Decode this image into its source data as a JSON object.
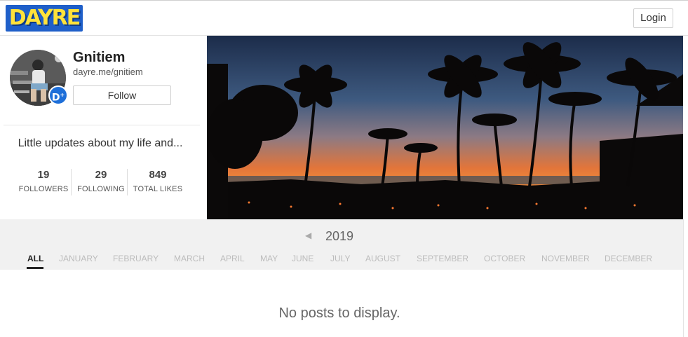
{
  "header": {
    "logo_text": "DAYRE",
    "login_label": "Login"
  },
  "profile": {
    "name": "Gnitiem",
    "handle": "dayre.me/gnitiem",
    "follow_label": "Follow",
    "badge_text": "D",
    "bio": "Little updates about my life and...",
    "stats": [
      {
        "value": "19",
        "label": "FOLLOWERS"
      },
      {
        "value": "29",
        "label": "FOLLOWING"
      },
      {
        "value": "849",
        "label": "TOTAL LIKES"
      }
    ]
  },
  "timeline": {
    "year": "2019",
    "months": [
      "ALL",
      "JANUARY",
      "FEBRUARY",
      "MARCH",
      "APRIL",
      "MAY",
      "JUNE",
      "JULY",
      "AUGUST",
      "SEPTEMBER",
      "OCTOBER",
      "NOVEMBER",
      "DECEMBER"
    ],
    "selected": "ALL"
  },
  "content": {
    "empty_message": "No posts to display."
  },
  "colors": {
    "logo_bg": "#1f5fc9",
    "logo_text": "#ffe23a",
    "badge": "#1e6fd9"
  },
  "icons": {
    "prev_year": "chevron-left-icon",
    "verified_badge": "dayre-badge-icon"
  }
}
